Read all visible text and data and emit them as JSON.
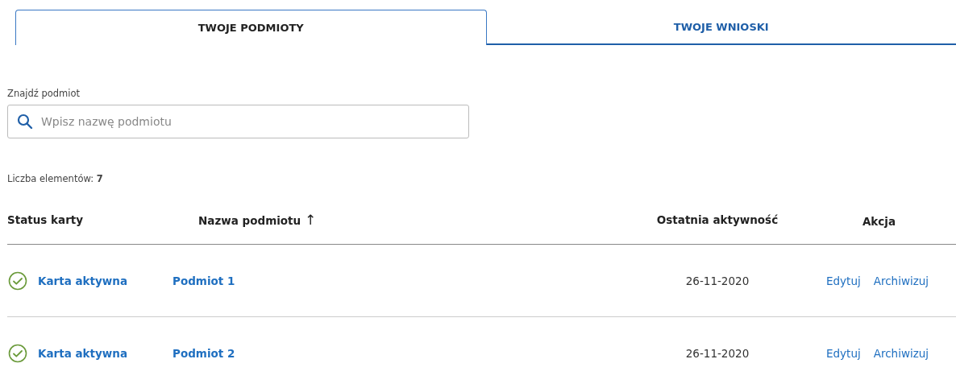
{
  "tabs": [
    {
      "label": "TWOJE PODMIOTY",
      "selected": true
    },
    {
      "label": "TWOJE WNIOSKI",
      "selected": false
    }
  ],
  "search": {
    "label": "Znajdź podmiot",
    "placeholder": "Wpisz nazwę podmiotu"
  },
  "count": {
    "label": "Liczba elementów:",
    "value": "7"
  },
  "table": {
    "columns": [
      {
        "label": "Status karty"
      },
      {
        "label": "Nazwa podmiotu",
        "sort_indicator": "↑"
      },
      {
        "label": "Ostatnia aktywność"
      },
      {
        "label": "Akcja"
      }
    ],
    "rows": [
      {
        "status": {
          "kind": "active",
          "label": "Karta aktywna"
        },
        "name": "Podmiot 1",
        "last_activity": "26-11-2020",
        "actions": [
          "Edytuj",
          "Archiwizuj"
        ]
      },
      {
        "status": {
          "kind": "active",
          "label": "Karta aktywna"
        },
        "name": "Podmiot 2",
        "last_activity": "26-11-2020",
        "actions": [
          "Edytuj",
          "Archiwizuj"
        ]
      }
    ]
  }
}
